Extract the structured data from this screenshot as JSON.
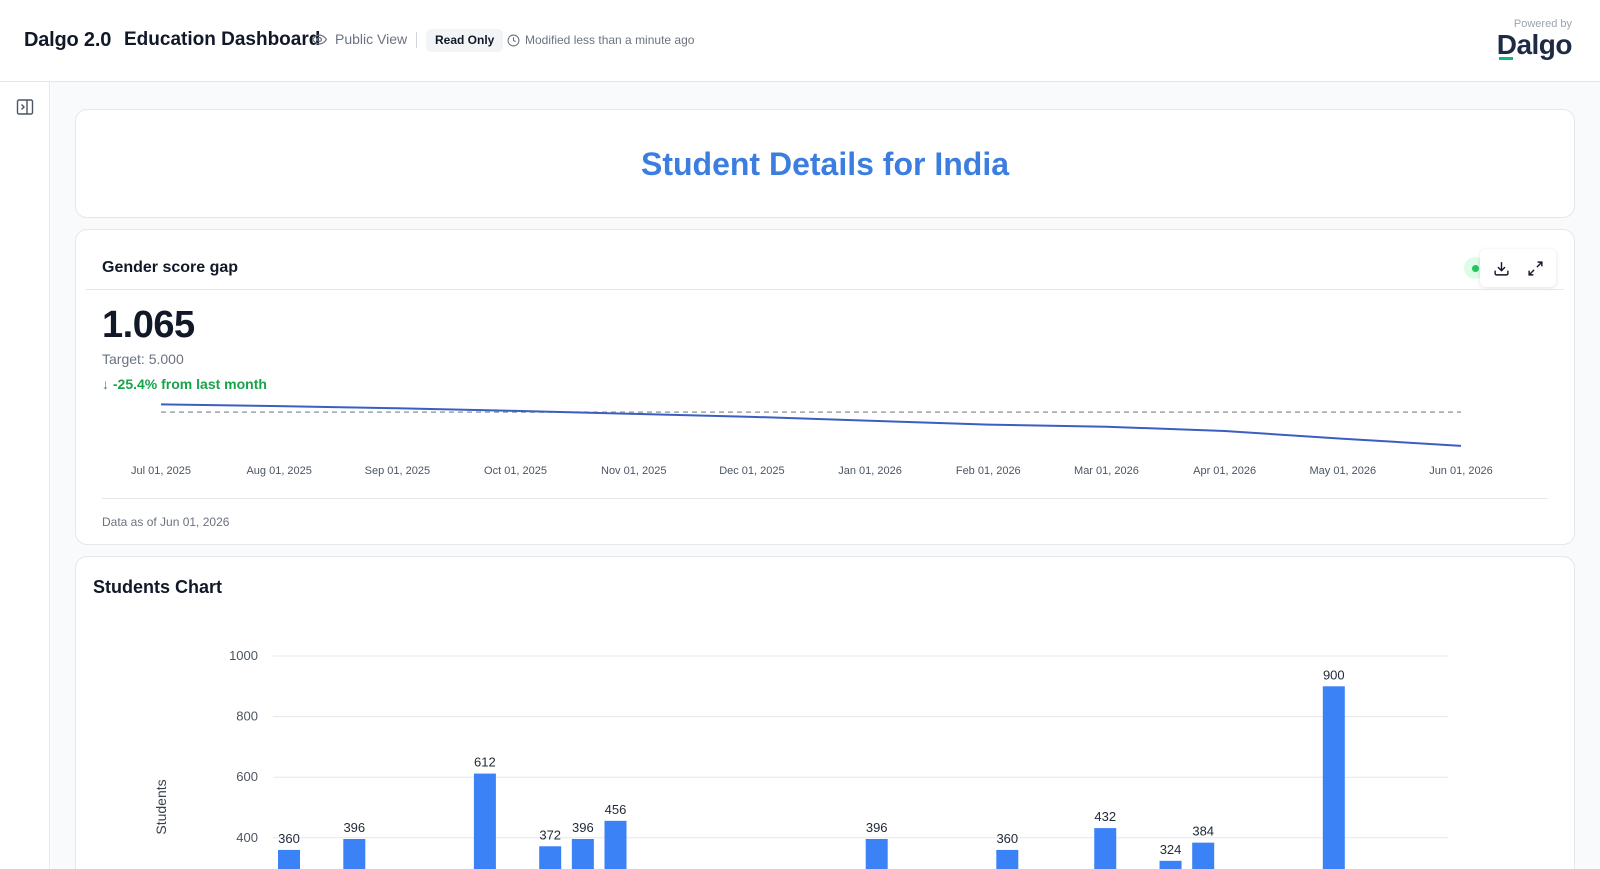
{
  "header": {
    "brand": "Dalgo 2.0",
    "dashboard_title": "Education Dashboard",
    "public_view_label": "Public View",
    "read_only_badge": "Read Only",
    "modified_text": "Modified less than a minute ago",
    "powered_by": "Powered by",
    "logo_text": "Dalgo"
  },
  "colors": {
    "title_blue": "#3b7ee0",
    "bar_blue": "#3b82f6",
    "line_blue": "#3b5fc0",
    "positive_green": "#16a34a"
  },
  "icons": [
    "eye-icon",
    "clock-icon",
    "sidebar-toggle-icon",
    "status-dot-icon",
    "download-icon",
    "expand-icon"
  ],
  "title_card": {
    "text": "Student Details for India"
  },
  "kpi": {
    "title": "Gender score gap",
    "value": "1.065",
    "target_text": "Target: 5.000",
    "change_text": "↓ -25.4% from last month",
    "footer": "Data as of Jun 01, 2026",
    "chart_data": {
      "type": "line",
      "x": [
        "Jul 01, 2025",
        "Aug 01, 2025",
        "Sep 01, 2025",
        "Oct 01, 2025",
        "Nov 01, 2025",
        "Dec 01, 2025",
        "Jan 01, 2026",
        "Feb 01, 2026",
        "Mar 01, 2026",
        "Apr 01, 2026",
        "May 01, 2026",
        "Jun 01, 2026"
      ],
      "series": [
        {
          "values": [
            5.9,
            5.7,
            5.45,
            5.15,
            4.8,
            4.45,
            4.0,
            3.55,
            3.3,
            2.8,
            1.9,
            1.065
          ]
        }
      ],
      "target": 5.0,
      "ylim": [
        0,
        7
      ],
      "grid": false
    }
  },
  "students_chart": {
    "title": "Students Chart",
    "chart_data": {
      "type": "bar",
      "ylabel": "Students",
      "yticks": [
        400,
        600,
        800,
        1000
      ],
      "ylim": [
        300,
        1000
      ],
      "grid": true,
      "values": [
        360,
        396,
        612,
        372,
        396,
        456,
        396,
        360,
        432,
        324,
        384,
        900
      ],
      "slots": [
        0,
        1,
        3,
        4,
        4.5,
        5,
        9,
        11,
        12.5,
        13.5,
        14,
        16
      ]
    }
  }
}
